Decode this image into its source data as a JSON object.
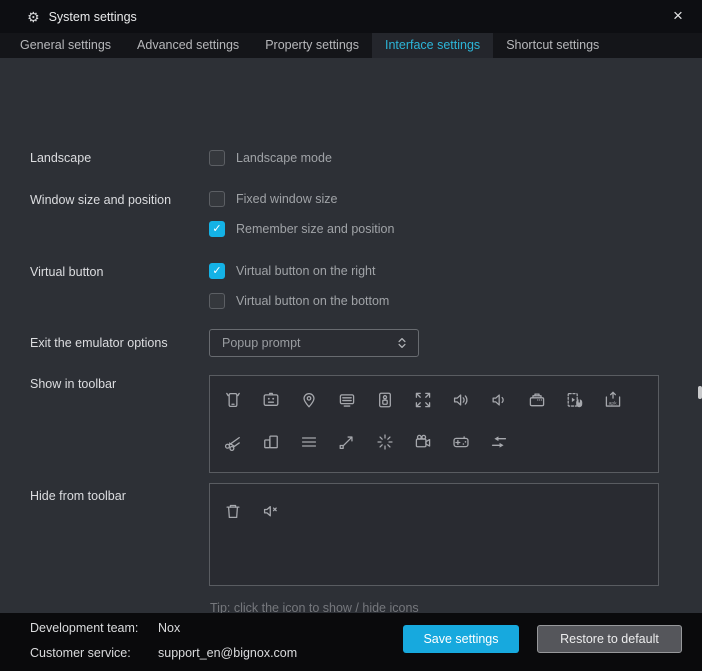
{
  "window": {
    "title": "System settings",
    "gear_glyph": "⚙",
    "close_glyph": "×"
  },
  "tabs": [
    {
      "label": "General settings",
      "active": false
    },
    {
      "label": "Advanced settings",
      "active": false
    },
    {
      "label": "Property settings",
      "active": false
    },
    {
      "label": "Interface settings",
      "active": true
    },
    {
      "label": "Shortcut settings",
      "active": false
    }
  ],
  "sections": {
    "landscape": {
      "label": "Landscape",
      "options": [
        {
          "text": "Landscape mode",
          "checked": false
        }
      ]
    },
    "window_size": {
      "label": "Window size and position",
      "options": [
        {
          "text": "Fixed window size",
          "checked": false
        },
        {
          "text": "Remember size and position",
          "checked": true
        }
      ]
    },
    "virtual_button": {
      "label": "Virtual button",
      "options": [
        {
          "text": "Virtual button on the right",
          "checked": true
        },
        {
          "text": "Virtual button on the bottom",
          "checked": false
        }
      ]
    },
    "exit_options": {
      "label": "Exit the emulator options",
      "selected": "Popup prompt"
    },
    "show_in_toolbar": {
      "label": "Show in toolbar",
      "icon_rows": [
        [
          "rotate-phone",
          "virtual-keyboard",
          "location",
          "monitor",
          "phone-frame",
          "fullscreen",
          "volume-up",
          "volume-down",
          "virtual-keys",
          "macro-recorder",
          "apk-install"
        ],
        [
          "screenshot-scissors",
          "multi-window",
          "menu",
          "resize",
          "loading-spinner",
          "screen-recorder",
          "gamepad",
          "swap-arrows"
        ]
      ]
    },
    "hide_from_toolbar": {
      "label": "Hide from toolbar",
      "icons": [
        "trash",
        "volume-mute"
      ]
    },
    "tip": "Tip: click the icon to show / hide icons"
  },
  "footer": {
    "info": [
      {
        "label": "Development team:",
        "value": "Nox"
      },
      {
        "label": "Customer service:",
        "value": "support_en@bignox.com"
      }
    ],
    "buttons": {
      "save": "Save settings",
      "restore": "Restore to default"
    }
  },
  "colors": {
    "accent": "#14b2e6",
    "active_tab_text": "#2cb5d8",
    "save_button": "#17a9de",
    "icon": "#a6a8ad"
  }
}
